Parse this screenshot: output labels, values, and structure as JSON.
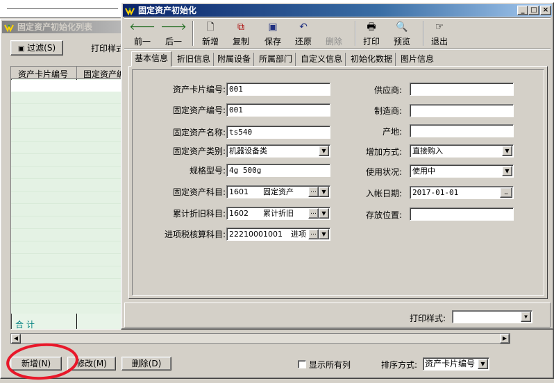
{
  "back_window": {
    "title": "固定资产初始化列表",
    "filter_button": "过滤(S)",
    "print_style_label": "打印样式",
    "columns": [
      "资产卡片编号",
      "固定资产编"
    ],
    "total_label": "合 计",
    "buttons": {
      "add": "新增(N)",
      "edit": "修改(M)",
      "delete": "删除(D)"
    },
    "show_all_label": "显示所有列",
    "sort_label": "排序方式:",
    "sort_value": "资产卡片编号"
  },
  "dialog": {
    "title": "固定资产初始化",
    "toolbar": [
      {
        "label": "前一",
        "icon": "arrow-left-icon"
      },
      {
        "label": "后一",
        "icon": "arrow-right-icon"
      },
      {
        "label": "新增",
        "icon": "new-doc-icon"
      },
      {
        "label": "复制",
        "icon": "copy-icon"
      },
      {
        "label": "保存",
        "icon": "save-icon"
      },
      {
        "label": "还原",
        "icon": "undo-icon"
      },
      {
        "label": "删除",
        "icon": "delete-icon",
        "disabled": true
      },
      {
        "label": "打印",
        "icon": "print-icon"
      },
      {
        "label": "预览",
        "icon": "preview-icon"
      },
      {
        "label": "退出",
        "icon": "exit-icon"
      }
    ],
    "tabs": [
      "基本信息",
      "折旧信息",
      "附属设备",
      "所属部门",
      "自定义信息",
      "初始化数据",
      "图片信息"
    ],
    "form": {
      "card_no": {
        "label": "资产卡片编号:",
        "value": "001"
      },
      "asset_no": {
        "label": "固定资产编号:",
        "value": "001"
      },
      "asset_name": {
        "label": "固定资产名称:",
        "value": "ts540"
      },
      "asset_type": {
        "label": "固定资产类别:",
        "value": "机器设备类"
      },
      "spec": {
        "label": "规格型号:",
        "value": "4g 500g"
      },
      "asset_account": {
        "label": "固定资产科目:",
        "code": "1601",
        "name": "固定资产"
      },
      "dep_account": {
        "label": "累计折旧科目:",
        "code": "1602",
        "name": "累计折旧"
      },
      "tax_account": {
        "label": "进项税核算科目:",
        "code": "22210001001",
        "name": "进项"
      },
      "supplier": {
        "label": "供应商:",
        "value": ""
      },
      "manufacturer": {
        "label": "制造商:",
        "value": ""
      },
      "origin": {
        "label": "产地:",
        "value": ""
      },
      "add_method": {
        "label": "增加方式:",
        "value": "直接购入"
      },
      "use_status": {
        "label": "使用状况:",
        "value": "使用中"
      },
      "entry_date": {
        "label": "入帐日期:",
        "value": "2017-01-01"
      },
      "location": {
        "label": "存放位置:",
        "value": ""
      }
    },
    "print_style_label": "打印样式:",
    "print_style_value": ""
  },
  "colors": {
    "title_active": "#0a246a",
    "highlight_ring": "#e8182a",
    "total_text": "#008080"
  }
}
